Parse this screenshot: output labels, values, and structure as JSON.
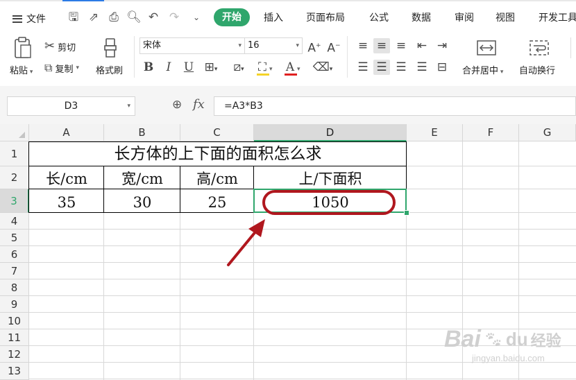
{
  "menu": {
    "file": "文件",
    "tabs": [
      "开始",
      "插入",
      "页面布局",
      "公式",
      "数据",
      "审阅",
      "视图",
      "开发工具"
    ]
  },
  "ribbon": {
    "paste": "粘贴",
    "cut": "剪切",
    "copy": "复制",
    "format_painter": "格式刷",
    "font_name": "宋体",
    "font_size": "16",
    "merge_center": "合并居中",
    "wrap_text": "自动换行"
  },
  "formula_bar": {
    "name_box": "D3",
    "fx": "fx",
    "formula": "=A3*B3"
  },
  "grid": {
    "columns": [
      "A",
      "B",
      "C",
      "D",
      "E",
      "F",
      "G"
    ],
    "rows": [
      "1",
      "2",
      "3",
      "4",
      "5",
      "6",
      "7",
      "8",
      "9",
      "10",
      "11",
      "12",
      "13"
    ],
    "title": "长方体的上下面的面积怎么求",
    "headers": [
      "长/cm",
      "宽/cm",
      "高/cm",
      "上/下面积"
    ],
    "values": [
      "35",
      "30",
      "25",
      "1050"
    ]
  },
  "annotation": {
    "color": "#b0171e"
  },
  "watermark": {
    "brand": "Bai",
    "paw": "du",
    "jingyan": "经验",
    "url": "jingyan.baidu.com"
  }
}
